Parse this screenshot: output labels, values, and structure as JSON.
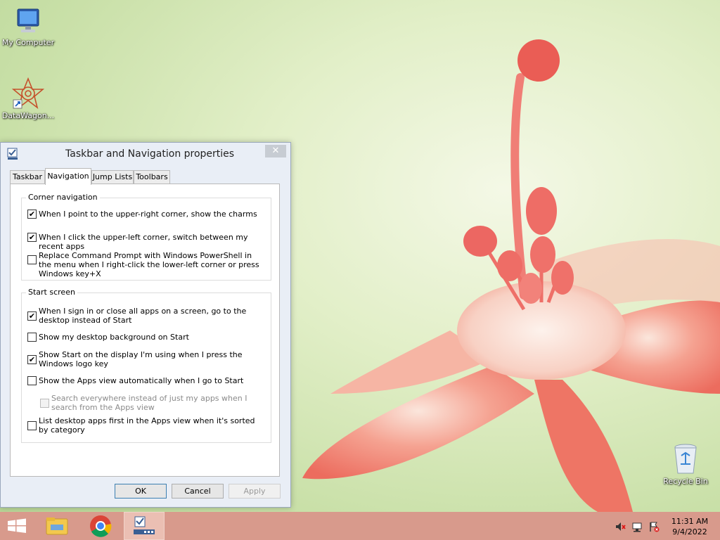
{
  "desktop": {
    "icons": [
      {
        "label": "My Computer",
        "icon": "monitor-icon"
      },
      {
        "label": "DataWagon...",
        "icon": "datawagon-logo-icon"
      },
      {
        "label": "Recycle Bin",
        "icon": "recycle-bin-icon"
      }
    ]
  },
  "dialog": {
    "title": "Taskbar and Navigation properties",
    "close_glyph": "✕",
    "tabs": [
      {
        "label": "Taskbar",
        "active": false
      },
      {
        "label": "Navigation",
        "active": true
      },
      {
        "label": "Jump Lists",
        "active": false
      },
      {
        "label": "Toolbars",
        "active": false
      }
    ],
    "corner_navigation": {
      "title": "Corner navigation",
      "options": [
        {
          "text": "When I point to the upper-right corner, show the charms",
          "checked": true,
          "enabled": true
        },
        {
          "text": "When I click the upper-left corner, switch between my recent apps",
          "checked": true,
          "enabled": true
        },
        {
          "text": "Replace Command Prompt with Windows PowerShell in the menu when I right-click the lower-left corner or press Windows key+X",
          "checked": false,
          "enabled": true
        }
      ]
    },
    "start_screen": {
      "title": "Start screen",
      "options": [
        {
          "text": "When I sign in or close all apps on a screen, go to the desktop instead of Start",
          "checked": true,
          "enabled": true
        },
        {
          "text": "Show my desktop background on Start",
          "checked": false,
          "enabled": true
        },
        {
          "text": "Show Start on the display I'm using when I press the Windows logo key",
          "checked": true,
          "enabled": true
        },
        {
          "text": "Show the Apps view automatically when I go to Start",
          "checked": false,
          "enabled": true
        },
        {
          "text": "Search everywhere instead of just my apps when I search from the Apps view",
          "checked": false,
          "enabled": false
        },
        {
          "text": "List desktop apps first in the Apps view when it's sorted by category",
          "checked": false,
          "enabled": true
        }
      ]
    },
    "buttons": {
      "ok": "OK",
      "cancel": "Cancel",
      "apply": "Apply"
    }
  },
  "taskbar": {
    "items": [
      {
        "icon": "windows-start-icon"
      },
      {
        "icon": "file-explorer-icon"
      },
      {
        "icon": "chrome-icon"
      },
      {
        "icon": "taskbar-properties-icon",
        "active": true
      }
    ],
    "tray": [
      "speaker-muted-icon",
      "network-icon",
      "action-center-flag-icon"
    ],
    "time": "11:31 AM",
    "date": "9/4/2022"
  },
  "colors": {
    "taskbar": "#d89a8c",
    "wallpaper_green": "#c9e0a8",
    "flower_pink": "#ef7a6e"
  }
}
